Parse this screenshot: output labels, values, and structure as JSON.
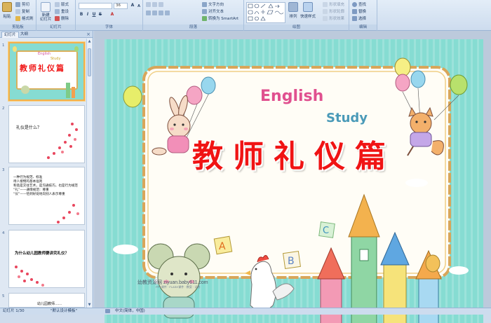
{
  "ribbon": {
    "clipboard": {
      "label": "剪贴板",
      "paste": "粘贴",
      "cut": "剪切",
      "copy": "复制",
      "format_painter": "格式刷"
    },
    "slides": {
      "label": "幻灯片",
      "new_slide": "新建\n幻灯片",
      "layout": "版式",
      "reset": "重设",
      "delete": "删除"
    },
    "font": {
      "label": "字体",
      "font_size": "36"
    },
    "paragraph": {
      "label": "段落",
      "text_direction": "文字方向",
      "align_text": "对齐文本",
      "convert_smartart": "转换为 SmartArt"
    },
    "drawing": {
      "label": "绘图",
      "arrange": "排列",
      "quick_styles": "快速样式",
      "shape_fill": "形状填充",
      "shape_outline": "形状轮廓",
      "shape_effects": "形状效果"
    },
    "editing": {
      "label": "编辑",
      "find": "查找",
      "replace": "替换",
      "select": "选择"
    }
  },
  "left_pane": {
    "tabs": [
      "幻灯片",
      "大纲"
    ],
    "close": "×",
    "slides": [
      {
        "num": "1",
        "text": "教师礼仪篇",
        "english": "English",
        "study": "Study"
      },
      {
        "num": "2",
        "text": "礼仪是什么？"
      },
      {
        "num": "3",
        "lines": [
          "一种行为规范、标准",
          "待人接物的基本准则",
          "和谐是交往艺术，是沟通技巧，也是行为规范",
          "“礼”——通情规范：尊重",
          "“仪”——恰到好处地向别人表示尊重"
        ]
      },
      {
        "num": "4",
        "text": "为什么幼儿园教师要讲究礼仪？"
      },
      {
        "num": "5",
        "text": "幼儿园教师……"
      }
    ]
  },
  "slide": {
    "title": "教师礼仪篇",
    "english": "English",
    "study": "Study",
    "letter_a": "A",
    "letter_b": "B",
    "letter_c": "C",
    "watermark": "幼教资源网 ziyuan.baby611.com",
    "watermark_sub": "PPT课件 · FLASH课件 · 教案 · 试卷"
  },
  "status": {
    "slide_info": "幻灯片 1/30",
    "theme": "\"默认设计模板\"",
    "language": "中文(简体，中国)"
  },
  "colors": {
    "ribbon_bg": "#dfe9f5",
    "title_red": "#f01414",
    "slide_bg": "#86dcd2",
    "selection": "#f3b04a"
  }
}
